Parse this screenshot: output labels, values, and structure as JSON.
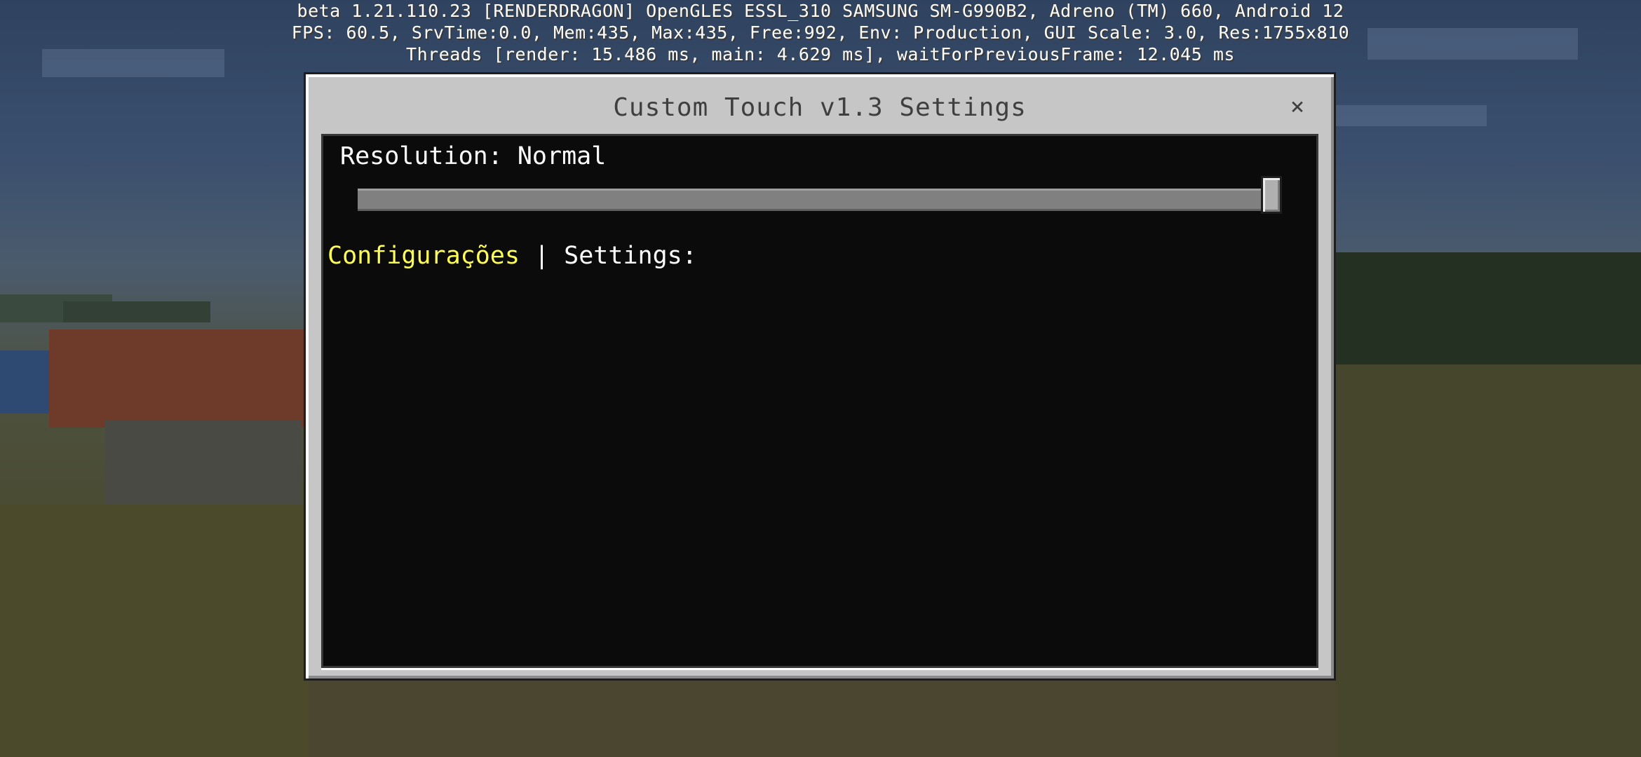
{
  "debug_overlay": {
    "line1": "beta 1.21.110.23 [RENDERDRAGON] OpenGLES ESSL_310 SAMSUNG SM-G990B2, Adreno (TM) 660, Android 12",
    "line2": "FPS: 60.5, SrvTime:0.0, Mem:435, Max:435, Free:992, Env: Production, GUI Scale: 3.0, Res:1755x810",
    "line3": "Threads [render: 15.486 ms, main: 4.629 ms], waitForPreviousFrame: 12.045 ms"
  },
  "dialog": {
    "title": "Custom Touch v1.3 Settings",
    "close_icon": "close-icon",
    "close_glyph": "×"
  },
  "resolution": {
    "label": "Resolution: Normal",
    "slider_value": 1.0
  },
  "settings_heading": {
    "pt": "Configurações",
    "separator": " | ",
    "en": "Settings:"
  },
  "colors": {
    "dialog_bg": "#c6c6c6",
    "panel_bg": "#0b0b0b",
    "heading_accent": "#ffff55",
    "text": "#ffffff"
  }
}
